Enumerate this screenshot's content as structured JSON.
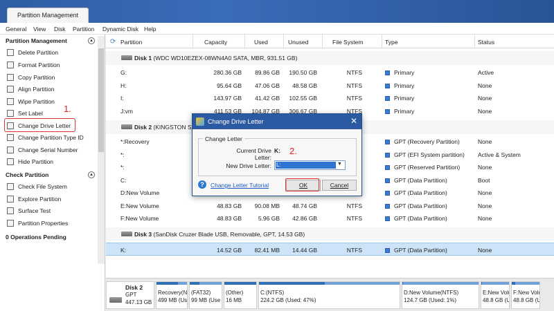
{
  "window": {
    "tab_title": "Partition Management"
  },
  "menu": [
    "General",
    "View",
    "Disk",
    "Partition",
    "Dynamic Disk",
    "Help"
  ],
  "sidebar": {
    "section1_title": "Partition Management",
    "section1_items": [
      "Delete Partition",
      "Format Partition",
      "Copy Partition",
      "Align Partition",
      "Wipe Partition",
      "Set Label",
      "Change Drive Letter",
      "Change Partition Type ID",
      "Change Serial Number",
      "Hide Partition"
    ],
    "section2_title": "Check Partition",
    "section2_items": [
      "Check File System",
      "Explore Partition",
      "Surface Test",
      "Partition Properties"
    ],
    "pending": "0 Operations Pending",
    "annotation": "1."
  },
  "table": {
    "columns": [
      "Partition",
      "Capacity",
      "Used",
      "Unused",
      "File System",
      "Type",
      "Status"
    ],
    "disk1_label": "Disk 1",
    "disk1_desc": "(WDC WD10EZEX-08WN4A0 SATA, MBR, 931.51 GB)",
    "disk1_rows": [
      [
        "G:",
        "280.36 GB",
        "89.86 GB",
        "190.50 GB",
        "NTFS",
        "Primary",
        "Active"
      ],
      [
        "H:",
        "95.64 GB",
        "47.06 GB",
        "48.58 GB",
        "NTFS",
        "Primary",
        "None"
      ],
      [
        "I:",
        "143.97 GB",
        "41.42 GB",
        "102.55 GB",
        "NTFS",
        "Primary",
        "None"
      ],
      [
        "J:vm",
        "411.53 GB",
        "104.87 GB",
        "306.67 GB",
        "NTFS",
        "Primary",
        "None"
      ]
    ],
    "disk2_label": "Disk 2",
    "disk2_desc": "(KINGSTON SA4",
    "disk2_rows": [
      [
        "*:Recovery",
        "",
        "",
        "",
        "",
        "GPT (Recovery Partition)",
        "None"
      ],
      [
        "*:",
        "",
        "",
        "",
        "",
        "GPT (EFI System partition)",
        "Active & System"
      ],
      [
        "*:",
        "",
        "",
        "",
        "",
        "GPT (Reserved Partition)",
        "None"
      ],
      [
        "C:",
        "",
        "",
        "",
        "",
        "GPT (Data Partition)",
        "Boot"
      ],
      [
        "D:New Volume",
        "",
        "",
        "",
        "",
        "GPT (Data Partition)",
        "None"
      ],
      [
        "E:New Volume",
        "48.83 GB",
        "90.08 MB",
        "48.74 GB",
        "NTFS",
        "GPT (Data Partition)",
        "None"
      ],
      [
        "F:New Volume",
        "48.83 GB",
        "5.96 GB",
        "42.86 GB",
        "NTFS",
        "GPT (Data Partition)",
        "None"
      ]
    ],
    "disk3_label": "Disk 3",
    "disk3_desc": "(SanDisk Cruzer Blade USB, Removable, GPT, 14.53 GB)",
    "disk3_rows": [
      [
        "K:",
        "14.52 GB",
        "82.41 MB",
        "14.44 GB",
        "NTFS",
        "GPT (Data Partition)",
        "None"
      ]
    ]
  },
  "diskmap": {
    "disk": {
      "name": "Disk 2",
      "style": "GPT",
      "size": "447.13 GB"
    },
    "parts": [
      {
        "l1": "Recovery(N",
        "l2": "499 MB (Us",
        "used_fraction": 0.7
      },
      {
        "l1": "(FAT32)",
        "l2": "99 MB (Use",
        "used_fraction": 0.3
      },
      {
        "l1": "(Other)",
        "l2": "16 MB",
        "used_fraction": 1.0
      },
      {
        "l1": "C:(NTFS)",
        "l2": "224.2 GB (Used: 47%)",
        "used_fraction": 0.47
      },
      {
        "l1": "D:New Volume(NTFS)",
        "l2": "124.7 GB (Used: 1%)",
        "used_fraction": 0.01
      },
      {
        "l1": "E:New Volu",
        "l2": "48.8 GB (U",
        "used_fraction": 0.02
      },
      {
        "l1": "F:New Volu",
        "l2": "48.8 GB (U",
        "used_fraction": 0.12
      }
    ]
  },
  "dialog": {
    "title": "Change Drive Letter",
    "group_label": "Change Letter",
    "current_label": "Current Drive Letter:",
    "current_value": "K:",
    "new_label": "New Drive Letter:",
    "new_value": "L:",
    "help_link": "Change Letter Tutorial",
    "ok": "OK",
    "cancel": "Cancel",
    "annotation": "2.",
    "close_glyph": "✕",
    "help_glyph": "?"
  },
  "colors": {
    "accent": "#2b5aa3",
    "highlight": "#e03030",
    "selection": "#cde3f7"
  }
}
